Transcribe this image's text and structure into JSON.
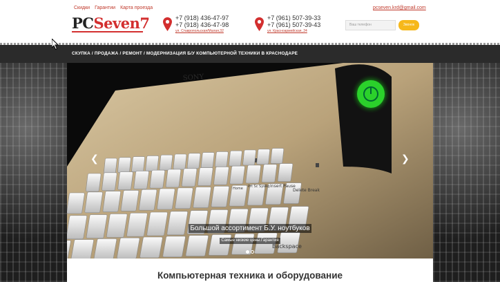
{
  "header": {
    "links": [
      "Скидки",
      "Гарантии",
      "Карта проезда"
    ],
    "logo": {
      "part1": "PC",
      "part2": "Seven",
      "part3": "7"
    },
    "contact1": {
      "phones": [
        "+7 (918) 436-47-97",
        "+7 (918) 436-47-98"
      ],
      "address": "ул. Ставропольская/Малая,32"
    },
    "contact2": {
      "phones": [
        "+7 (961) 507-39-33",
        "+7 (961) 507-39-43"
      ],
      "address": "ул. Красноармейская, 24"
    },
    "email": "pcseven.krd@gmail.com",
    "phone_placeholder": "Ваш телефон",
    "call_button": "Звонок"
  },
  "nav": {
    "text": "СКУПКА / ПРОДАЖА / РЕМОНТ / МОДЕРНИЗАЦИЯ Б/У КОМПЬЮТЕРНОЙ ТЕХНИКИ В КРАСНОДАРЕ"
  },
  "slider": {
    "brand": "SONY",
    "title": "Большой ассортимент Б.У. ноутбуков",
    "subtitle": "Самые низкие цены.Гарантия",
    "slide_count": 2,
    "active_slide": 1,
    "keys": [
      "Insert Pause",
      "Delete Break",
      "Prt Sc SysRq",
      "Home",
      "Backspace"
    ]
  },
  "main": {
    "section_title": "Компьютерная техника и оборудование"
  },
  "colors": {
    "accent": "#d32f2f",
    "button": "#f6b81b",
    "nav_bg": "#2b2b2b"
  }
}
